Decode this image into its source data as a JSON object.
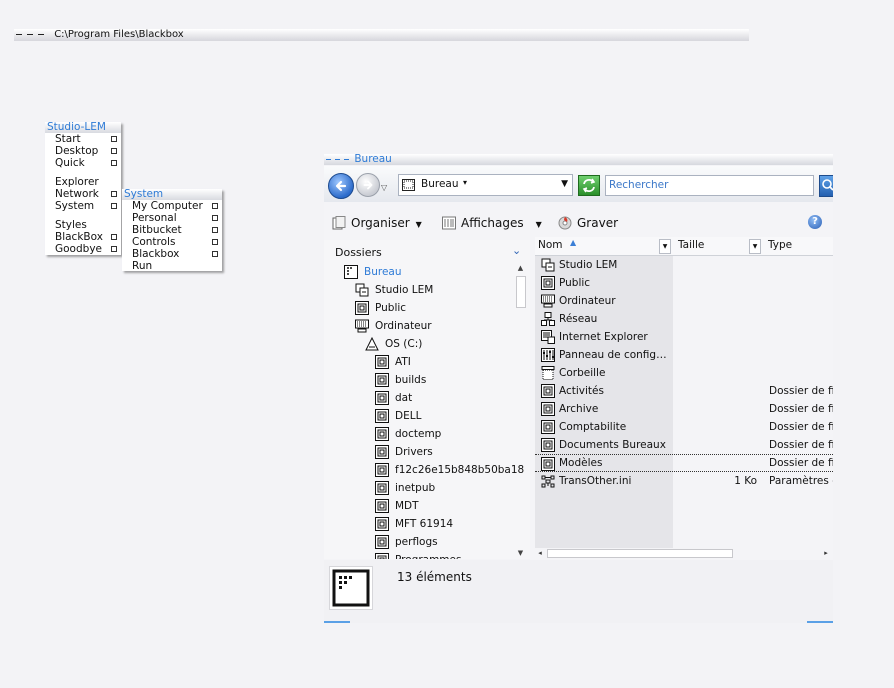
{
  "toolbar": {
    "path": "C:\\Program Files\\Blackbox"
  },
  "menu_root": {
    "title": "Studio-LEM",
    "groups": [
      [
        "Start",
        "Desktop",
        "Quick"
      ],
      [
        "Explorer",
        "Network",
        "System"
      ],
      [
        "Styles",
        "BlackBox",
        "Goodbye"
      ]
    ],
    "submenus": [
      "Start",
      "Desktop",
      "Quick",
      "Network",
      "System",
      "BlackBox",
      "Goodbye"
    ]
  },
  "menu_system": {
    "title": "System",
    "items": [
      "My Computer",
      "Personal",
      "Bitbucket",
      "Controls",
      "Blackbox",
      "Run"
    ]
  },
  "explorer": {
    "title": "Bureau",
    "address": "Bureau",
    "search_placeholder": "Rechercher",
    "commands": {
      "organize": "Organiser",
      "views": "Affichages",
      "burn": "Graver"
    },
    "help": "?",
    "folders_header": "Dossiers",
    "tree": [
      {
        "label": "Bureau",
        "level": 0,
        "icon": "desktop-icon",
        "selected": true
      },
      {
        "label": "Studio LEM",
        "level": 1,
        "icon": "user-icon"
      },
      {
        "label": "Public",
        "level": 1,
        "icon": "folder-icon"
      },
      {
        "label": "Ordinateur",
        "level": 1,
        "icon": "computer-icon"
      },
      {
        "label": "OS (C:)",
        "level": 2,
        "icon": "drive-icon"
      },
      {
        "label": "ATI",
        "level": 3,
        "icon": "folder-icon"
      },
      {
        "label": "builds",
        "level": 3,
        "icon": "folder-icon"
      },
      {
        "label": "dat",
        "level": 3,
        "icon": "folder-icon"
      },
      {
        "label": "DELL",
        "level": 3,
        "icon": "folder-icon"
      },
      {
        "label": "doctemp",
        "level": 3,
        "icon": "folder-icon"
      },
      {
        "label": "Drivers",
        "level": 3,
        "icon": "folder-icon"
      },
      {
        "label": "f12c26e15b848b50ba18",
        "level": 3,
        "icon": "folder-icon"
      },
      {
        "label": "inetpub",
        "level": 3,
        "icon": "folder-icon"
      },
      {
        "label": "MDT",
        "level": 3,
        "icon": "folder-icon"
      },
      {
        "label": "MFT 61914",
        "level": 3,
        "icon": "folder-icon"
      },
      {
        "label": "perflogs",
        "level": 3,
        "icon": "folder-icon"
      },
      {
        "label": "Programmes",
        "level": 3,
        "icon": "folder-icon"
      }
    ],
    "columns": {
      "name": "Nom",
      "size": "Taille",
      "type": "Type"
    },
    "files": [
      {
        "name": "Studio LEM",
        "size": "",
        "type": "",
        "icon": "user-icon"
      },
      {
        "name": "Public",
        "size": "",
        "type": "",
        "icon": "folder-icon"
      },
      {
        "name": "Ordinateur",
        "size": "",
        "type": "",
        "icon": "computer-icon"
      },
      {
        "name": "Réseau",
        "size": "",
        "type": "",
        "icon": "network-icon"
      },
      {
        "name": "Internet Explorer",
        "size": "",
        "type": "",
        "icon": "internet-explorer-icon"
      },
      {
        "name": "Panneau de configuration",
        "size": "",
        "type": "",
        "icon": "control-panel-icon"
      },
      {
        "name": "Corbeille",
        "size": "",
        "type": "",
        "icon": "recycle-bin-icon"
      },
      {
        "name": "Activités",
        "size": "",
        "type": "Dossier de fichiers",
        "icon": "folder-icon"
      },
      {
        "name": "Archive",
        "size": "",
        "type": "Dossier de fichiers",
        "icon": "folder-icon"
      },
      {
        "name": "Comptabilite",
        "size": "",
        "type": "Dossier de fichiers",
        "icon": "folder-icon"
      },
      {
        "name": "Documents Bureaux",
        "size": "",
        "type": "Dossier de fichiers",
        "icon": "folder-icon"
      },
      {
        "name": "Modèles",
        "size": "",
        "type": "Dossier de fichiers",
        "icon": "folder-icon",
        "selected": true
      },
      {
        "name": "TransOther.ini",
        "size": "1 Ko",
        "type": "Paramètres de configuration",
        "icon": "ini-file-icon"
      }
    ],
    "status_count": "13 éléments"
  }
}
